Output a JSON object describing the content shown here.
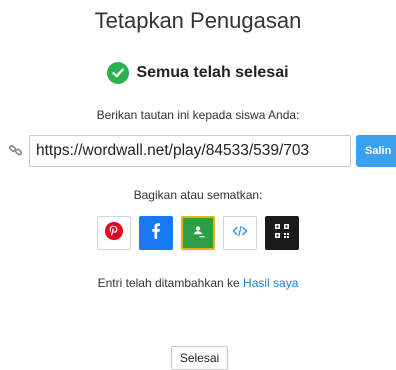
{
  "dialog": {
    "title": "Tetapkan Penugasan",
    "status": {
      "icon": "check-circle-icon",
      "text": "Semua telah selesai",
      "color": "#2bb24c"
    },
    "instruction": "Berikan tautan ini kepada siswa Anda:",
    "link": {
      "icon": "link-icon",
      "url": "https://wordwall.net/play/84533/539/703",
      "copy_label": "Salin",
      "copy_color": "#3aa0f0"
    },
    "share": {
      "label": "Bagikan atau sematkan:",
      "buttons": [
        {
          "name": "pinterest",
          "icon": "pinterest-icon"
        },
        {
          "name": "facebook",
          "icon": "facebook-icon"
        },
        {
          "name": "google-classroom",
          "icon": "google-classroom-icon"
        },
        {
          "name": "embed",
          "icon": "embed-code-icon"
        },
        {
          "name": "qr-code",
          "icon": "qr-code-icon"
        }
      ]
    },
    "entry_note": {
      "text": "Entri telah ditambahkan ke ",
      "link_text": "Hasil saya"
    },
    "done_label": "Selesai"
  }
}
